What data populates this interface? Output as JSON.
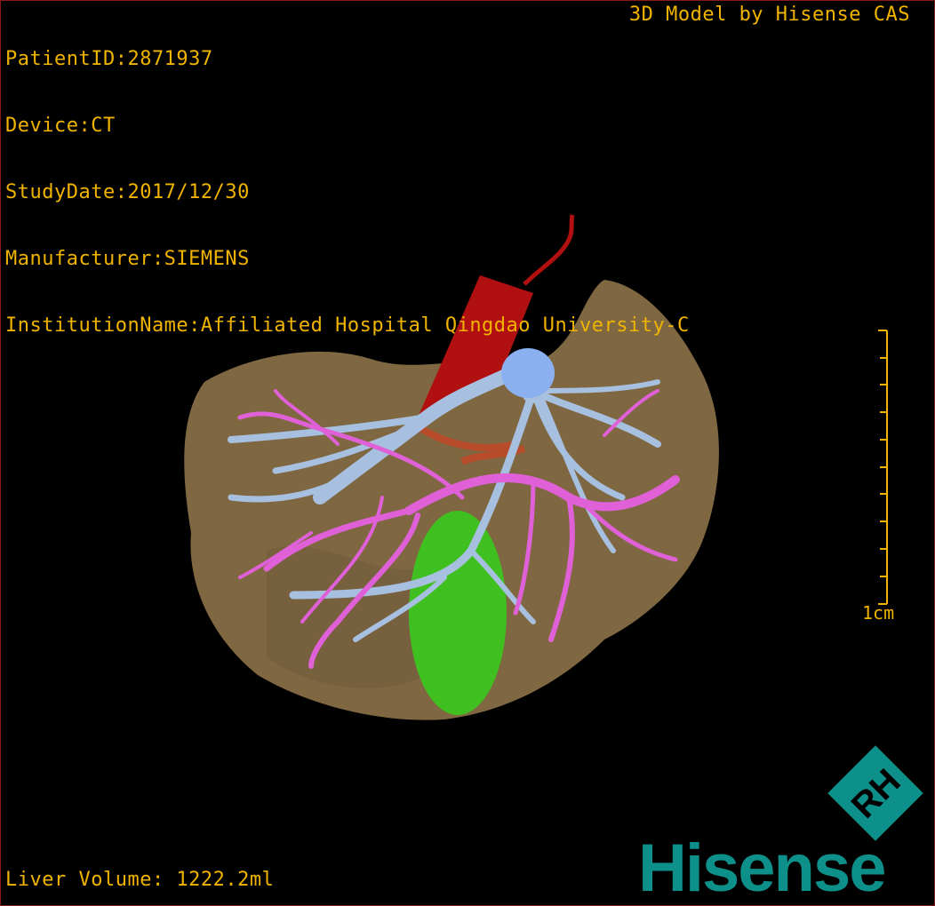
{
  "info": {
    "patient_id": "PatientID:2871937",
    "device": "Device:CT",
    "study_date": "StudyDate:2017/12/30",
    "manufacturer": "Manufacturer:SIEMENS",
    "institution": "InstitutionName:Affiliated Hospital Qingdao University-C"
  },
  "model_label": "3D Model by Hisense CAS",
  "liver_volume": "Liver Volume: 1222.2ml",
  "scale_bar": {
    "label": "1cm"
  },
  "logo": {
    "text": "Hisense",
    "mark_text": "RH"
  },
  "colors": {
    "text": "#f0b400",
    "liver": "#8a7048",
    "artery": "#b01010",
    "portal_vein": "#a8c0e0",
    "hepatic_vein": "#e060d8",
    "gallbladder": "#40c020",
    "logo": "#0d8f8a"
  }
}
